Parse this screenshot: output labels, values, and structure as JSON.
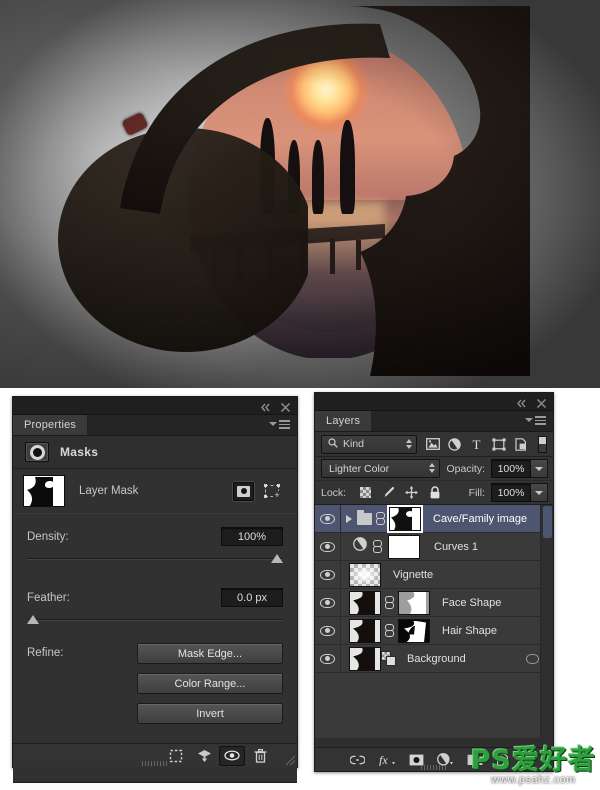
{
  "artwork": {
    "description": "double-exposure portrait of a woman silhouette with a beach sunset and family scene inside",
    "alt": "Cave/Family image double exposure"
  },
  "properties_panel": {
    "window_title": "Properties",
    "tab_label": "Properties",
    "section_title": "Masks",
    "section_icon": "pixel-mask-icon",
    "mask_row": {
      "label": "Layer Mask",
      "thumbnail_icon": "layer-mask-thumbnail",
      "pixel_mask_button": "pixel-mask-button",
      "vector_mask_button": "vector-mask-button"
    },
    "controls": [
      {
        "label": "Density:",
        "value": "100%",
        "slider_percent": 100
      },
      {
        "label": "Feather:",
        "value": "0.0 px",
        "slider_percent": 0
      }
    ],
    "refine": {
      "label": "Refine:",
      "buttons": [
        "Mask Edge...",
        "Color Range...",
        "Invert"
      ]
    },
    "footer_icons": [
      {
        "name": "load-selection-from-mask-icon",
        "active": false
      },
      {
        "name": "apply-mask-icon",
        "active": false
      },
      {
        "name": "toggle-mask-visibility-icon",
        "active": true
      },
      {
        "name": "delete-mask-icon",
        "active": false
      }
    ],
    "titlebar_icons": [
      "collapse-to-icons-icon",
      "close-panel-icon"
    ],
    "menu_icon": "panel-menu-icon"
  },
  "layers_panel": {
    "window_title": "Layers",
    "tab_label": "Layers",
    "filter": {
      "kind_label": "Kind",
      "search_icon": "search-icon",
      "type_filters": [
        "filter-pixel-layers-icon",
        "filter-adjustment-layers-icon",
        "filter-type-layers-icon",
        "filter-shape-layers-icon",
        "filter-smart-object-layers-icon"
      ],
      "toggle_icon": "filter-enable-toggle"
    },
    "blend_mode": "Lighter Color",
    "opacity": {
      "label": "Opacity:",
      "value": "100%"
    },
    "fill": {
      "label": "Fill:",
      "value": "100%"
    },
    "lock": {
      "label": "Lock:",
      "icons": [
        "lock-transparent-pixels-icon",
        "lock-image-pixels-icon",
        "lock-position-icon",
        "lock-all-icon"
      ]
    },
    "layers": [
      {
        "name": "Cave/Family image",
        "visible": true,
        "selected": true,
        "type": "group",
        "has_disclosure": true,
        "has_folder": true,
        "has_link": true,
        "thumb": "t-cave",
        "thumb_selected": true
      },
      {
        "name": "Curves 1",
        "visible": true,
        "selected": false,
        "type": "adjustment",
        "has_adjustment_icon": true,
        "has_link": true,
        "thumb": "t-white"
      },
      {
        "name": "Vignette",
        "visible": true,
        "selected": false,
        "type": "pixel",
        "thumb": "t-vig"
      },
      {
        "name": "Face Shape",
        "visible": true,
        "selected": false,
        "type": "pixel-with-mask",
        "has_link": true,
        "thumb": "t-photo",
        "mask_thumb": "t-maskface"
      },
      {
        "name": "Hair Shape",
        "visible": true,
        "selected": false,
        "type": "pixel-with-mask",
        "has_link": true,
        "thumb": "t-photo",
        "mask_thumb": "t-maskhair"
      },
      {
        "name": "Background",
        "visible": true,
        "selected": false,
        "type": "background",
        "thumb": "t-photo",
        "has_bg_badge": true,
        "has_row_eye": true,
        "has_row_caret": true
      }
    ],
    "footer_icons": [
      "link-layers-icon",
      "layer-style-fx-icon",
      "add-layer-mask-icon",
      "new-adjustment-layer-icon",
      "new-group-icon",
      "new-layer-icon",
      "delete-layer-icon"
    ],
    "titlebar_icons": [
      "collapse-to-icons-icon",
      "close-panel-icon"
    ],
    "menu_icon": "panel-menu-icon"
  },
  "watermark": {
    "main": "PS爱好者",
    "sub": "www.psahz.com",
    "color": "#2f9e3c"
  }
}
